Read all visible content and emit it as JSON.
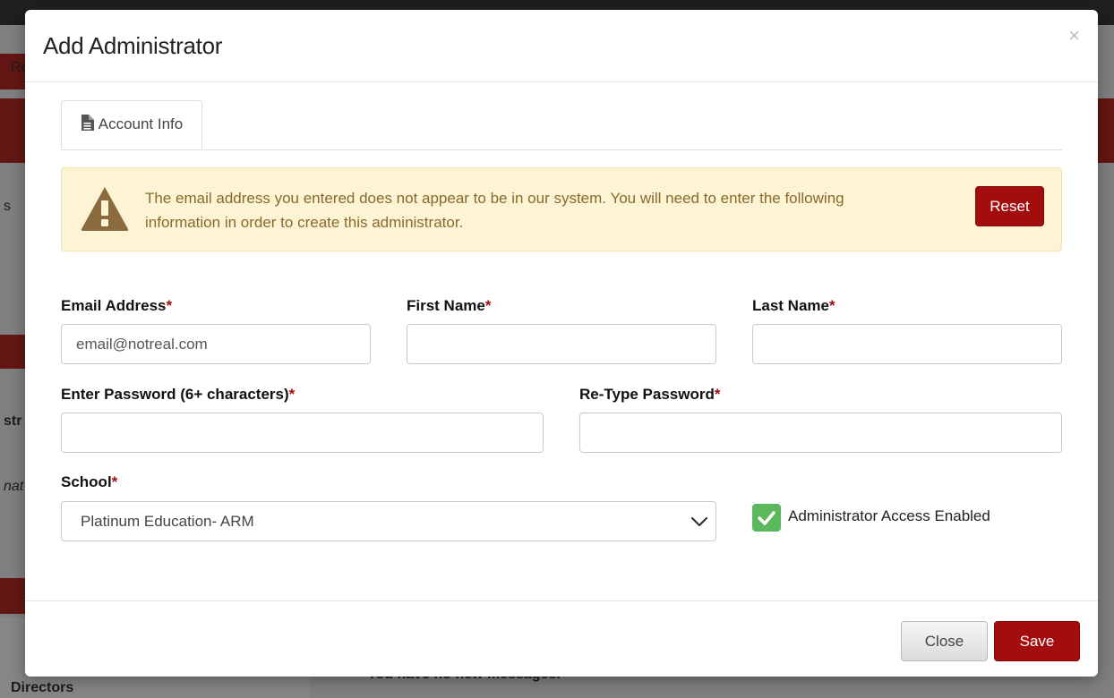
{
  "background": {
    "visible_fragments": [
      "Re",
      "s",
      "str",
      "nat",
      "Directors",
      "You have no new messages."
    ]
  },
  "modal": {
    "title": "Add Administrator",
    "close_glyph": "×",
    "tabs": [
      {
        "label": "Account Info",
        "icon": "document-icon",
        "active": true
      }
    ],
    "alert": {
      "icon": "warning-triangle-icon",
      "message": "The email address you entered does not appear to be in our system. You will need to enter the following information in order to create this administrator.",
      "reset_label": "Reset"
    },
    "fields": {
      "required_marker": "*",
      "email": {
        "label": "Email Address",
        "value": "email@notreal.com"
      },
      "first_name": {
        "label": "First Name",
        "value": ""
      },
      "last_name": {
        "label": "Last Name",
        "value": ""
      },
      "password": {
        "label": "Enter Password (6+ characters)",
        "value": ""
      },
      "retype_password": {
        "label": "Re-Type Password",
        "value": ""
      },
      "school": {
        "label": "School",
        "value": "Platinum Education- ARM"
      },
      "admin_access": {
        "label": "Administrator Access Enabled",
        "checked": true
      }
    },
    "footer": {
      "close_label": "Close",
      "save_label": "Save"
    }
  },
  "colors": {
    "accent_red": "#a40d0d",
    "alert_bg": "#fcf4d4",
    "alert_text": "#8a6a2b",
    "check_green": "#5cb85c"
  }
}
